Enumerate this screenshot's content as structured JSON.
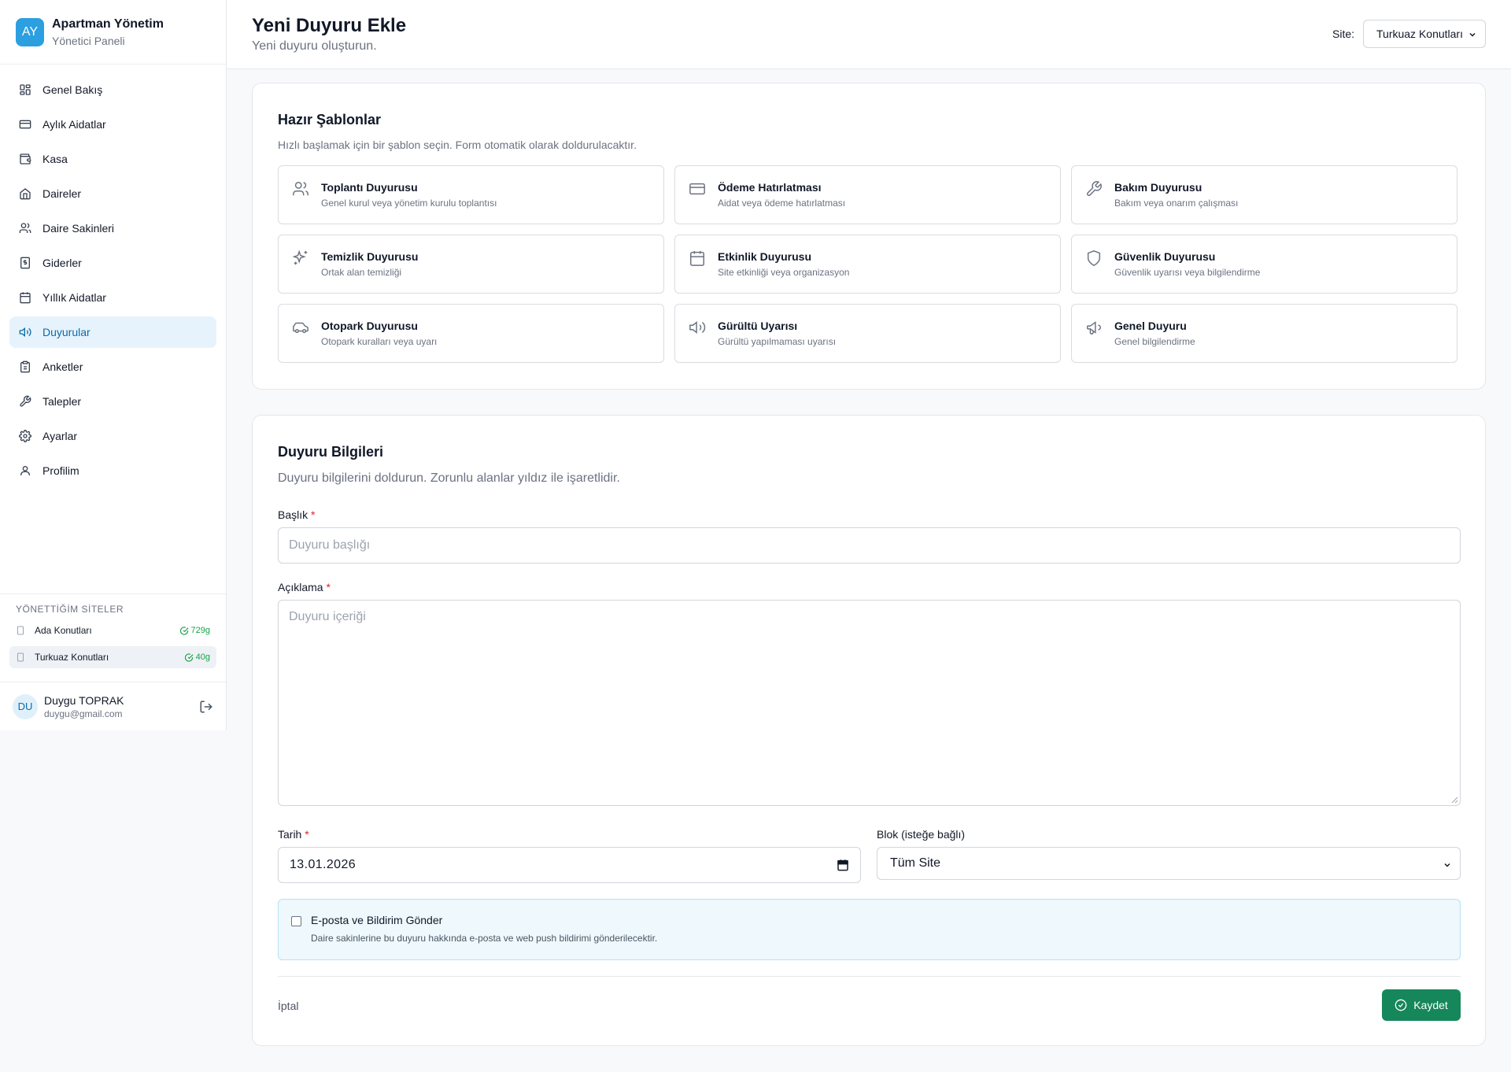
{
  "brand": {
    "logo": "AY",
    "title": "Apartman Yönetim",
    "subtitle": "Yönetici Paneli"
  },
  "nav": {
    "items": [
      {
        "label": "Genel Bakış",
        "icon": "dashboard-icon"
      },
      {
        "label": "Aylık Aidatlar",
        "icon": "credit-card-icon"
      },
      {
        "label": "Kasa",
        "icon": "wallet-icon"
      },
      {
        "label": "Daireler",
        "icon": "home-icon"
      },
      {
        "label": "Daire Sakinleri",
        "icon": "users-icon"
      },
      {
        "label": "Giderler",
        "icon": "receipt-icon"
      },
      {
        "label": "Yıllık Aidatlar",
        "icon": "calendar-icon"
      },
      {
        "label": "Duyurular",
        "icon": "megaphone-icon",
        "active": true
      },
      {
        "label": "Anketler",
        "icon": "clipboard-icon"
      },
      {
        "label": "Talepler",
        "icon": "wrench-icon"
      },
      {
        "label": "Ayarlar",
        "icon": "gear-icon"
      },
      {
        "label": "Profilim",
        "icon": "user-icon"
      }
    ]
  },
  "sites": {
    "title": "YÖNETTİĞİM SİTELER",
    "items": [
      {
        "name": "Ada Konutları",
        "badge": "729g",
        "active": false
      },
      {
        "name": "Turkuaz Konutları",
        "badge": "40g",
        "active": true
      }
    ]
  },
  "user": {
    "initials": "DU",
    "name": "Duygu TOPRAK",
    "email": "duygu@gmail.com"
  },
  "header": {
    "title": "Yeni Duyuru Ekle",
    "subtitle": "Yeni duyuru oluşturun.",
    "site_label": "Site:",
    "site_value": "Turkuaz Konutları"
  },
  "templates": {
    "title": "Hazır Şablonlar",
    "description": "Hızlı başlamak için bir şablon seçin. Form otomatik olarak doldurulacaktır.",
    "items": [
      {
        "name": "Toplantı Duyurusu",
        "desc": "Genel kurul veya yönetim kurulu toplantısı",
        "icon": "users-icon"
      },
      {
        "name": "Ödeme Hatırlatması",
        "desc": "Aidat veya ödeme hatırlatması",
        "icon": "credit-card-icon"
      },
      {
        "name": "Bakım Duyurusu",
        "desc": "Bakım veya onarım çalışması",
        "icon": "wrench-icon"
      },
      {
        "name": "Temizlik Duyurusu",
        "desc": "Ortak alan temizliği",
        "icon": "sparkles-icon"
      },
      {
        "name": "Etkinlik Duyurusu",
        "desc": "Site etkinliği veya organizasyon",
        "icon": "calendar-icon"
      },
      {
        "name": "Güvenlik Duyurusu",
        "desc": "Güvenlik uyarısı veya bilgilendirme",
        "icon": "shield-icon"
      },
      {
        "name": "Otopark Duyurusu",
        "desc": "Otopark kuralları veya uyarı",
        "icon": "car-icon"
      },
      {
        "name": "Gürültü Uyarısı",
        "desc": "Gürültü yapılmaması uyarısı",
        "icon": "volume-icon"
      },
      {
        "name": "Genel Duyuru",
        "desc": "Genel bilgilendirme",
        "icon": "megaphone-icon"
      }
    ]
  },
  "form": {
    "title": "Duyuru Bilgileri",
    "description": "Duyuru bilgilerini doldurun. Zorunlu alanlar yıldız ile işaretlidir.",
    "required_mark": "*",
    "title_label": "Başlık",
    "title_placeholder": "Duyuru başlığı",
    "content_label": "Açıklama",
    "content_placeholder": "Duyuru içeriği",
    "date_label": "Tarih",
    "date_value": "13.01.2026",
    "block_label": "Blok (isteğe bağlı)",
    "block_value": "Tüm Site",
    "notify_title": "E-posta ve Bildirim Gönder",
    "notify_desc": "Daire sakinlerine bu duyuru hakkında e-posta ve web push bildirimi gönderilecektir.",
    "notify_checked": false,
    "cancel_label": "İptal",
    "save_label": "Kaydet"
  },
  "colors": {
    "accent": "#2b9fe0",
    "save": "#16875a",
    "required": "#dc2626",
    "active_nav_bg": "#e6f3fc"
  }
}
